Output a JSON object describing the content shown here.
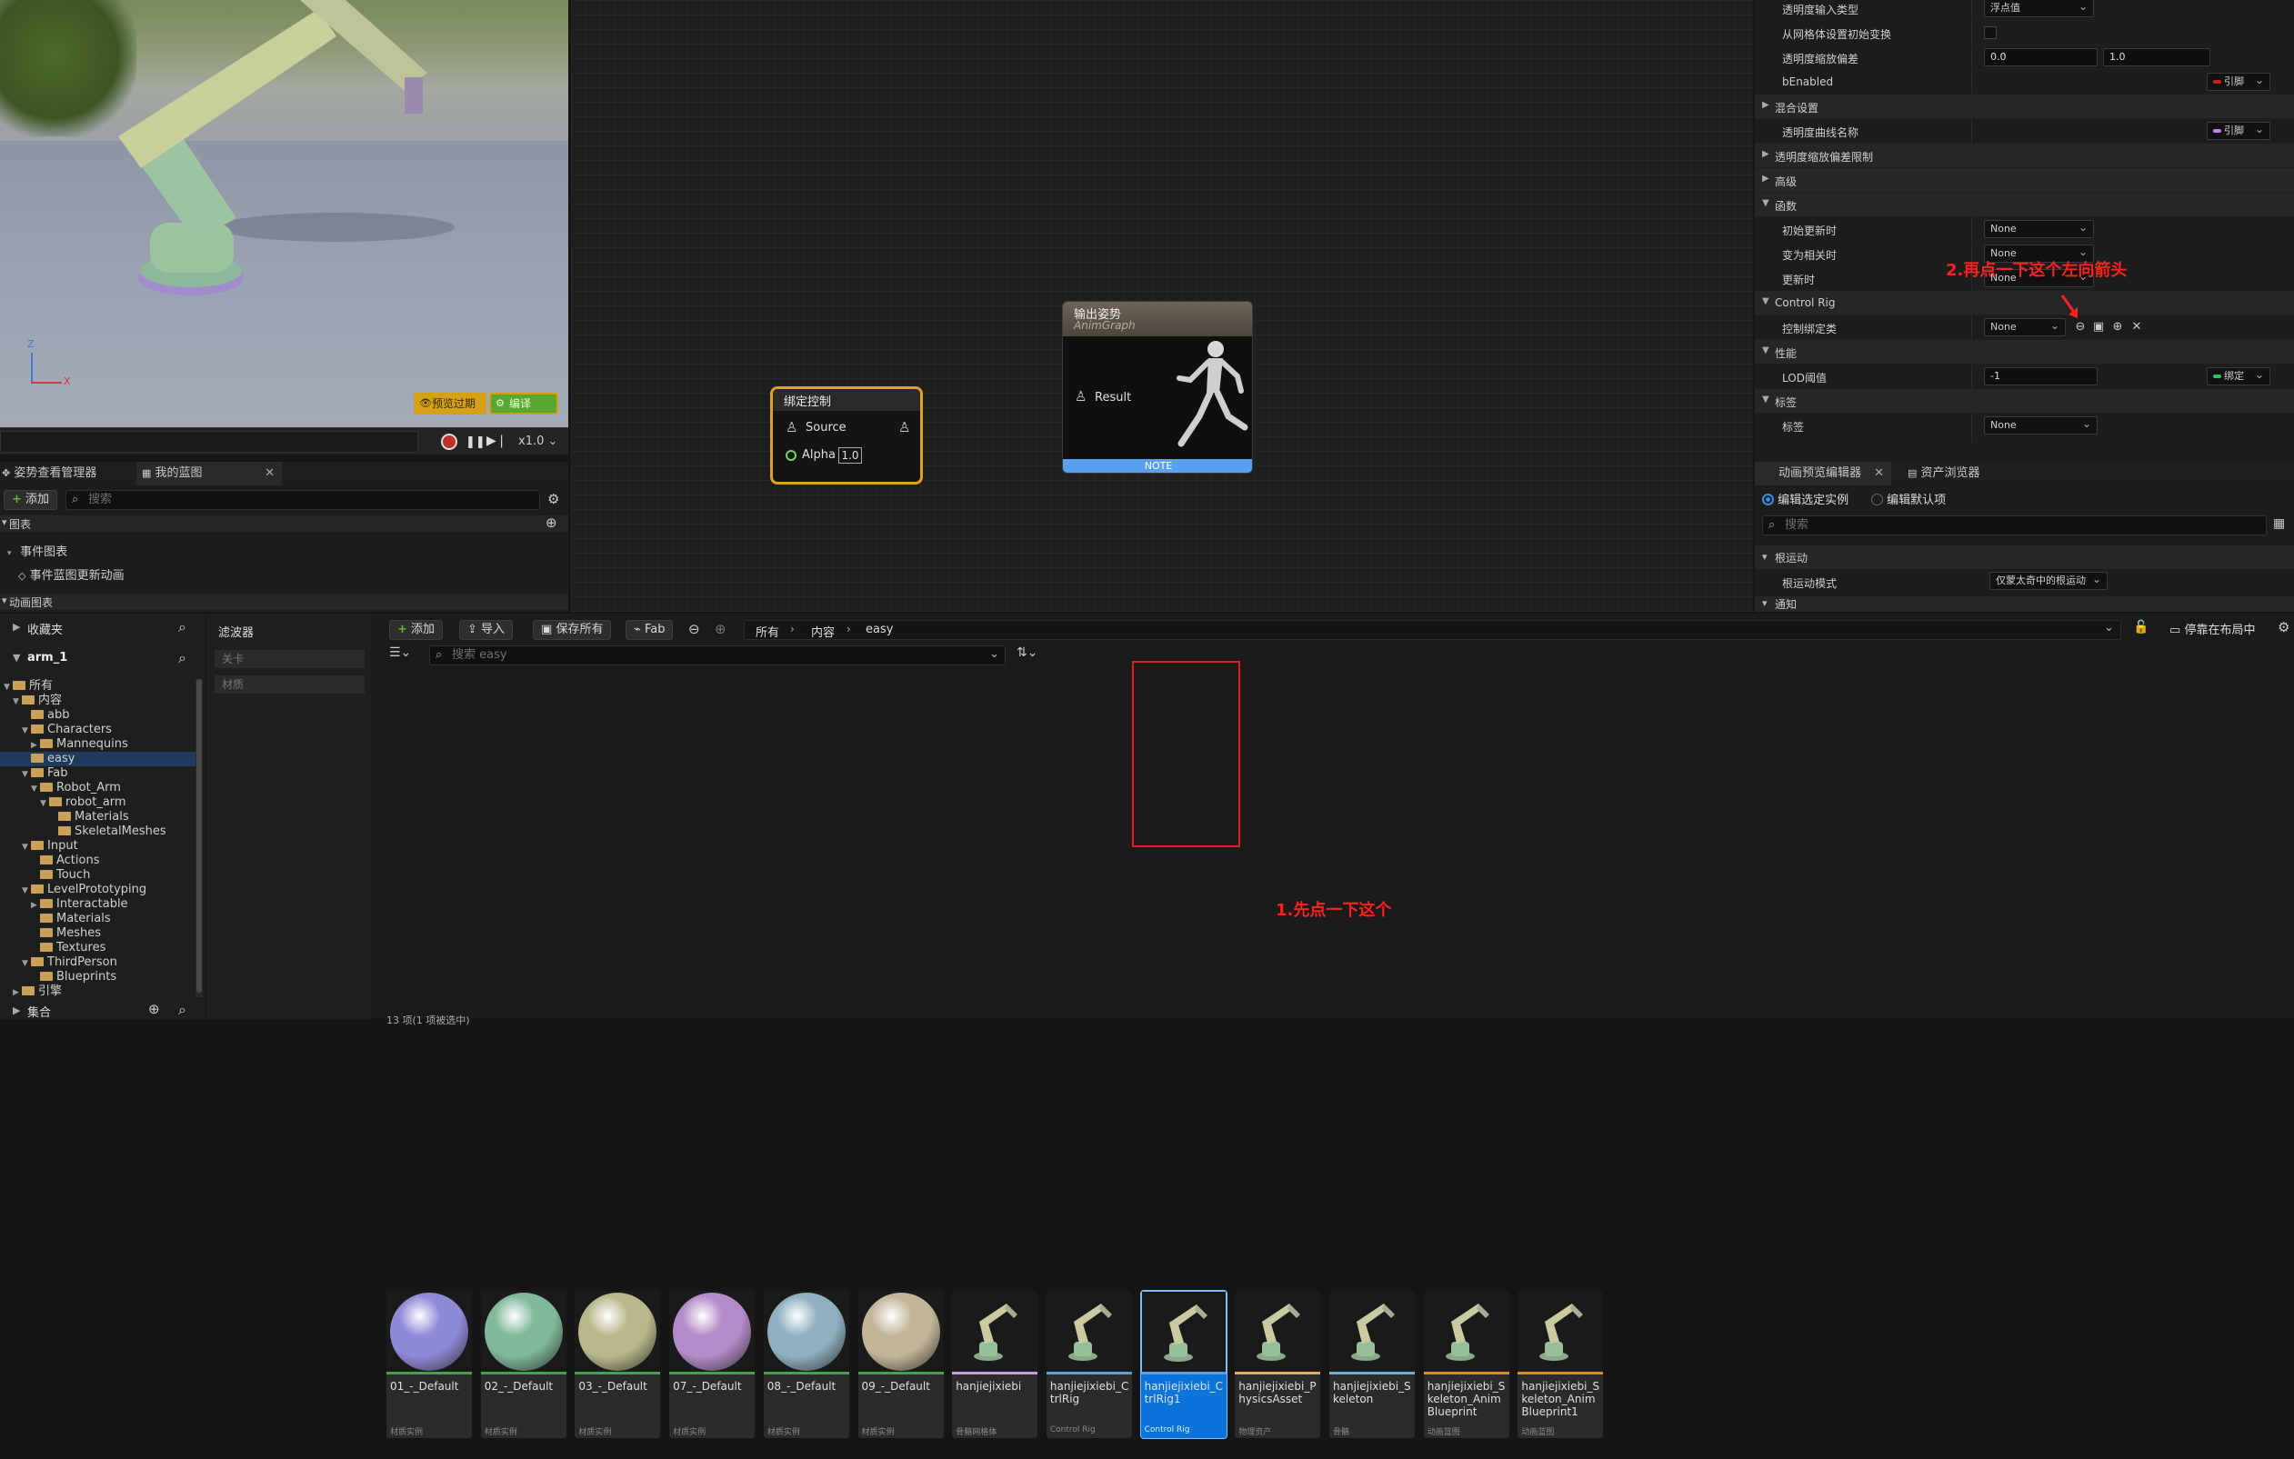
{
  "viewport": {
    "axis_z": "Z",
    "axis_x": "X",
    "preview_badge": "预览过期",
    "compile_button": "编译",
    "speed_label": "x1.0"
  },
  "left_panel": {
    "tabs": [
      {
        "label": "姿势查看管理器"
      },
      {
        "label": "我的蓝图"
      }
    ],
    "add_label": "添加",
    "search_placeholder": "搜索",
    "section_graph": "图表",
    "event_graph": "事件图表",
    "event_update": "事件蓝图更新动画",
    "section_anim_graph": "动画图表"
  },
  "graph": {
    "node_bind": {
      "title": "绑定控制",
      "pin_source": "Source",
      "pin_alpha": "Alpha",
      "alpha_value": "1.0"
    },
    "node_output": {
      "title": "输出姿势",
      "subtitle": "AnimGraph",
      "pin_result": "Result",
      "note": "NOTE"
    }
  },
  "details": {
    "rows": [
      {
        "label": "透明度输入类型",
        "value": "浮点值"
      },
      {
        "label": "从网格体设置初始变换",
        "value": ""
      },
      {
        "label": "透明度缩放偏差",
        "value_a": "0.0",
        "value_b": "1.0"
      },
      {
        "label": "bEnabled",
        "value": "引脚"
      },
      {
        "label": "混合设置"
      },
      {
        "label": "透明度曲线名称",
        "value": "引脚"
      },
      {
        "label": "透明度缩放偏差限制"
      },
      {
        "label": "高级"
      },
      {
        "label": "函数"
      },
      {
        "label": "初始更新时",
        "value": "None"
      },
      {
        "label": "变为相关时",
        "value": "None"
      },
      {
        "label": "更新时",
        "value": "None"
      },
      {
        "label": "Control Rig"
      },
      {
        "label": "控制绑定类",
        "value": "None"
      },
      {
        "label": "性能"
      },
      {
        "label": "LOD阈值",
        "value": "-1",
        "pin": "绑定"
      },
      {
        "label": "标签"
      },
      {
        "label": "标签",
        "value": "None"
      }
    ],
    "annotation_2": "2.再点一下这个左向箭头"
  },
  "anim_preview": {
    "tabs": [
      {
        "label": "动画预览编辑器"
      },
      {
        "label": "资产浏览器"
      }
    ],
    "radio_selected": "编辑选定实例",
    "radio_default": "编辑默认项",
    "search_placeholder": "搜索",
    "section_root_motion": "根运动",
    "root_motion_mode_label": "根运动模式",
    "root_motion_mode_value": "仅蒙太奇中的根运动",
    "section_notify": "通知"
  },
  "content_browser": {
    "favorites": "收藏夹",
    "project_name": "arm_1",
    "filters_label": "滤波器",
    "filter_items": [
      "关卡",
      "材质"
    ],
    "tree": [
      {
        "label": "所有",
        "depth": 0,
        "caret": "open"
      },
      {
        "label": "内容",
        "depth": 1,
        "caret": "open"
      },
      {
        "label": "abb",
        "depth": 2,
        "caret": ""
      },
      {
        "label": "Characters",
        "depth": 2,
        "caret": "open"
      },
      {
        "label": "Mannequins",
        "depth": 3,
        "caret": "closed"
      },
      {
        "label": "easy",
        "depth": 2,
        "caret": "",
        "selected": true
      },
      {
        "label": "Fab",
        "depth": 2,
        "caret": "open"
      },
      {
        "label": "Robot_Arm",
        "depth": 3,
        "caret": "open"
      },
      {
        "label": "robot_arm",
        "depth": 4,
        "caret": "open"
      },
      {
        "label": "Materials",
        "depth": 5,
        "caret": ""
      },
      {
        "label": "SkeletalMeshes",
        "depth": 5,
        "caret": ""
      },
      {
        "label": "Input",
        "depth": 2,
        "caret": "open"
      },
      {
        "label": "Actions",
        "depth": 3,
        "caret": ""
      },
      {
        "label": "Touch",
        "depth": 3,
        "caret": ""
      },
      {
        "label": "LevelPrototyping",
        "depth": 2,
        "caret": "open"
      },
      {
        "label": "Interactable",
        "depth": 3,
        "caret": "closed"
      },
      {
        "label": "Materials",
        "depth": 3,
        "caret": ""
      },
      {
        "label": "Meshes",
        "depth": 3,
        "caret": ""
      },
      {
        "label": "Textures",
        "depth": 3,
        "caret": ""
      },
      {
        "label": "ThirdPerson",
        "depth": 2,
        "caret": "open"
      },
      {
        "label": "Blueprints",
        "depth": 3,
        "caret": ""
      },
      {
        "label": "引擎",
        "depth": 1,
        "caret": "closed"
      }
    ],
    "collections_label": "集合",
    "toolbar": {
      "add": "添加",
      "import": "导入",
      "save_all": "保存所有",
      "fab": "Fab"
    },
    "breadcrumb": [
      "所有",
      "内容",
      "easy"
    ],
    "search_placeholder": "搜索 easy",
    "dock_label": "停靠在布局中",
    "assets": [
      {
        "name": "01_-_Default",
        "type": "材质实例",
        "color": "#8f8ad8",
        "bar": "#3aa84a",
        "kind": "sphere"
      },
      {
        "name": "02_-_Default",
        "type": "材质实例",
        "color": "#7fb89a",
        "bar": "#3aa84a",
        "kind": "sphere"
      },
      {
        "name": "03_-_Default",
        "type": "材质实例",
        "color": "#b9b88a",
        "bar": "#3aa84a",
        "kind": "sphere"
      },
      {
        "name": "07_-_Default",
        "type": "材质实例",
        "color": "#b48ac8",
        "bar": "#3aa84a",
        "kind": "sphere"
      },
      {
        "name": "08_-_Default",
        "type": "材质实例",
        "color": "#8eb0c0",
        "bar": "#3aa84a",
        "kind": "sphere"
      },
      {
        "name": "09_-_Default",
        "type": "材质实例",
        "color": "#c2b598",
        "bar": "#3aa84a",
        "kind": "sphere"
      },
      {
        "name": "hanjiejixiebi",
        "type": "骨骼网格体",
        "color": "#c8cba0",
        "bar": "#c89ae0",
        "kind": "arm"
      },
      {
        "name": "hanjiejixiebi_CtrlRig",
        "type": "Control Rig",
        "color": "#c8cba0",
        "bar": "#5aa0e0",
        "kind": "arm"
      },
      {
        "name": "hanjiejixiebi_CtrlRig1",
        "type": "Control Rig",
        "color": "#c8cba0",
        "bar": "#5aa0e0",
        "kind": "arm",
        "selected": true
      },
      {
        "name": "hanjiejixiebi_PhysicsAsset",
        "type": "物理资产",
        "color": "#c8cba0",
        "bar": "#e0b050",
        "kind": "arm"
      },
      {
        "name": "hanjiejixiebi_Skeleton",
        "type": "骨骼",
        "color": "#c8cba0",
        "bar": "#6ab0d8",
        "kind": "arm"
      },
      {
        "name": "hanjiejixiebi_Skeleton_AnimBlueprint",
        "type": "动画蓝图",
        "color": "#c8cba0",
        "bar": "#e08a30",
        "kind": "arm"
      },
      {
        "name": "hanjiejixiebi_Skeleton_AnimBlueprint1",
        "type": "动画蓝图",
        "color": "#c8cba0",
        "bar": "#e08a30",
        "kind": "arm"
      }
    ],
    "annotation_1": "1.先点一下这个",
    "status": "13 项(1 项被选中)"
  }
}
